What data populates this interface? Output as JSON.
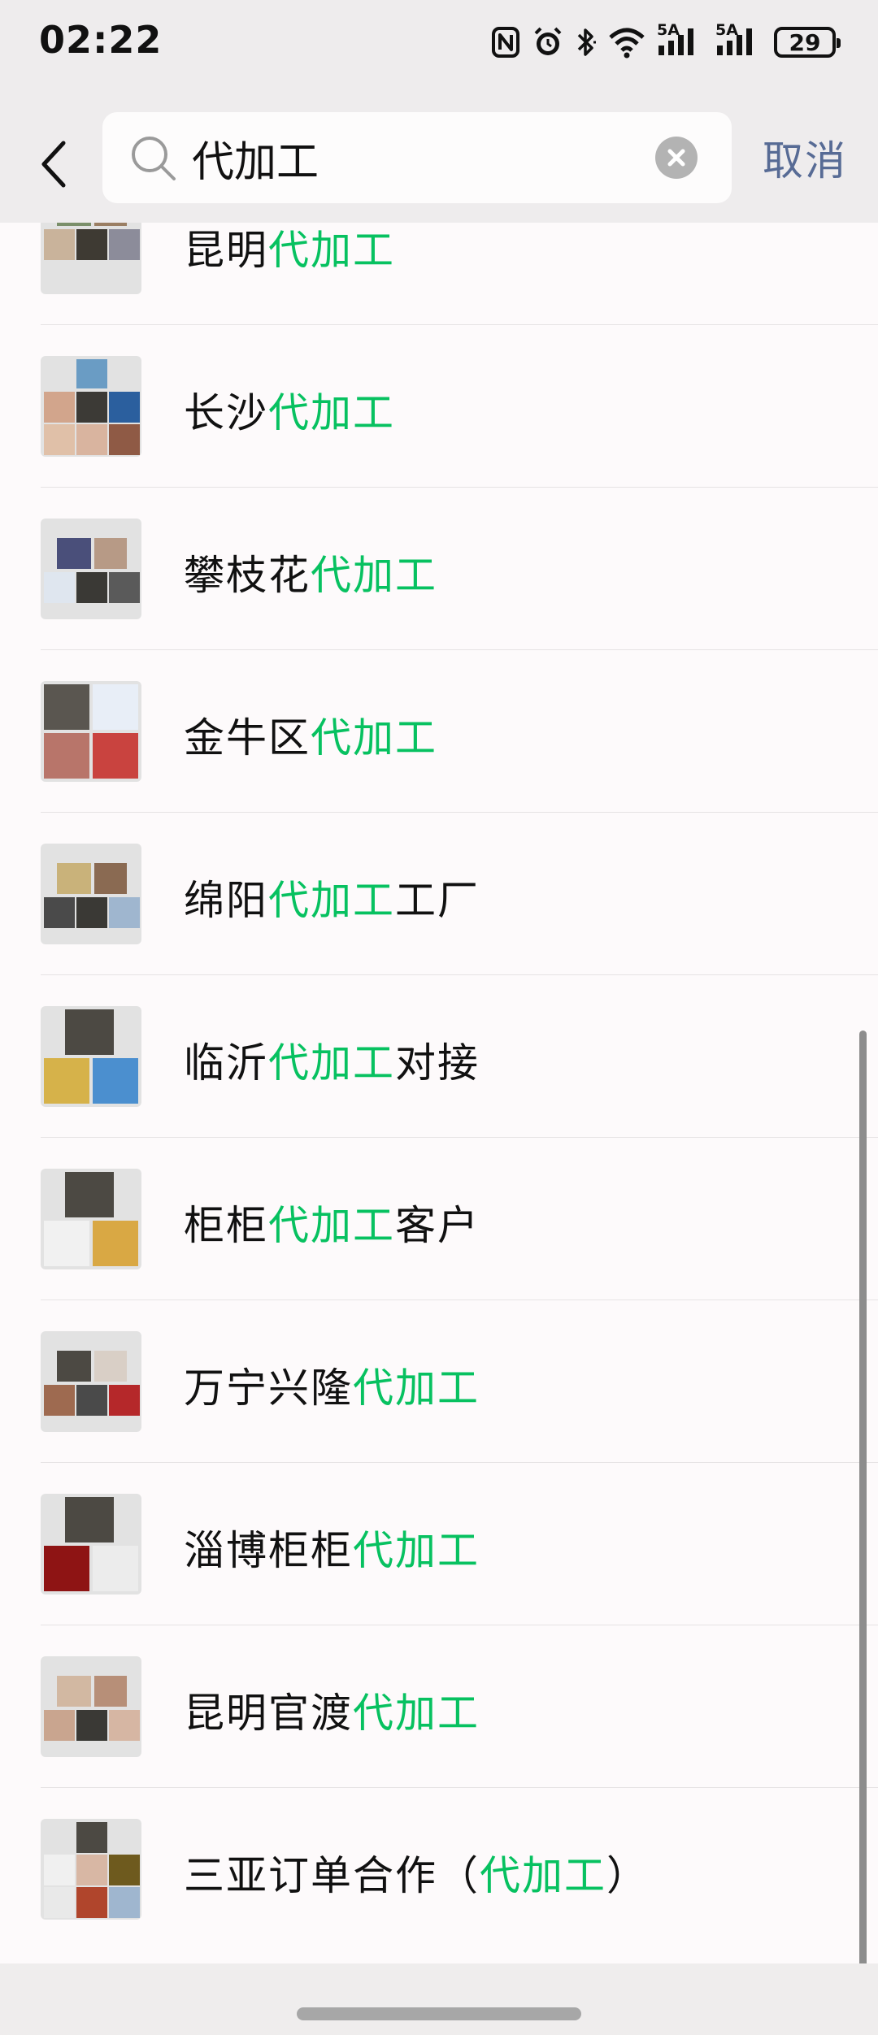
{
  "status": {
    "time": "02:22",
    "network1": "5A",
    "network2": "5A",
    "battery": "29",
    "icons": [
      "nfc-icon",
      "alarm-icon",
      "bluetooth-icon",
      "wifi-icon",
      "signal-icon",
      "signal-icon",
      "battery-icon"
    ]
  },
  "search": {
    "query": "代加工",
    "cancel_label": "取消"
  },
  "results": [
    {
      "prefix": "昆明",
      "highlight": "代加工",
      "suffix": ""
    },
    {
      "prefix": "长沙",
      "highlight": "代加工",
      "suffix": ""
    },
    {
      "prefix": "攀枝花",
      "highlight": "代加工",
      "suffix": ""
    },
    {
      "prefix": "金牛区",
      "highlight": "代加工",
      "suffix": ""
    },
    {
      "prefix": "绵阳",
      "highlight": "代加工",
      "suffix": "工厂"
    },
    {
      "prefix": "临沂",
      "highlight": "代加工",
      "suffix": "对接"
    },
    {
      "prefix": "柜柜",
      "highlight": "代加工",
      "suffix": "客户"
    },
    {
      "prefix": "万宁兴隆",
      "highlight": "代加工",
      "suffix": ""
    },
    {
      "prefix": "淄博柜柜",
      "highlight": "代加工",
      "suffix": ""
    },
    {
      "prefix": "昆明官渡",
      "highlight": "代加工",
      "suffix": ""
    },
    {
      "prefix": "三亚订单合作（",
      "highlight": "代加工",
      "suffix": "）"
    }
  ],
  "colors": {
    "highlight": "#07c160",
    "cancel": "#576b95",
    "header_bg": "#eeeced"
  }
}
